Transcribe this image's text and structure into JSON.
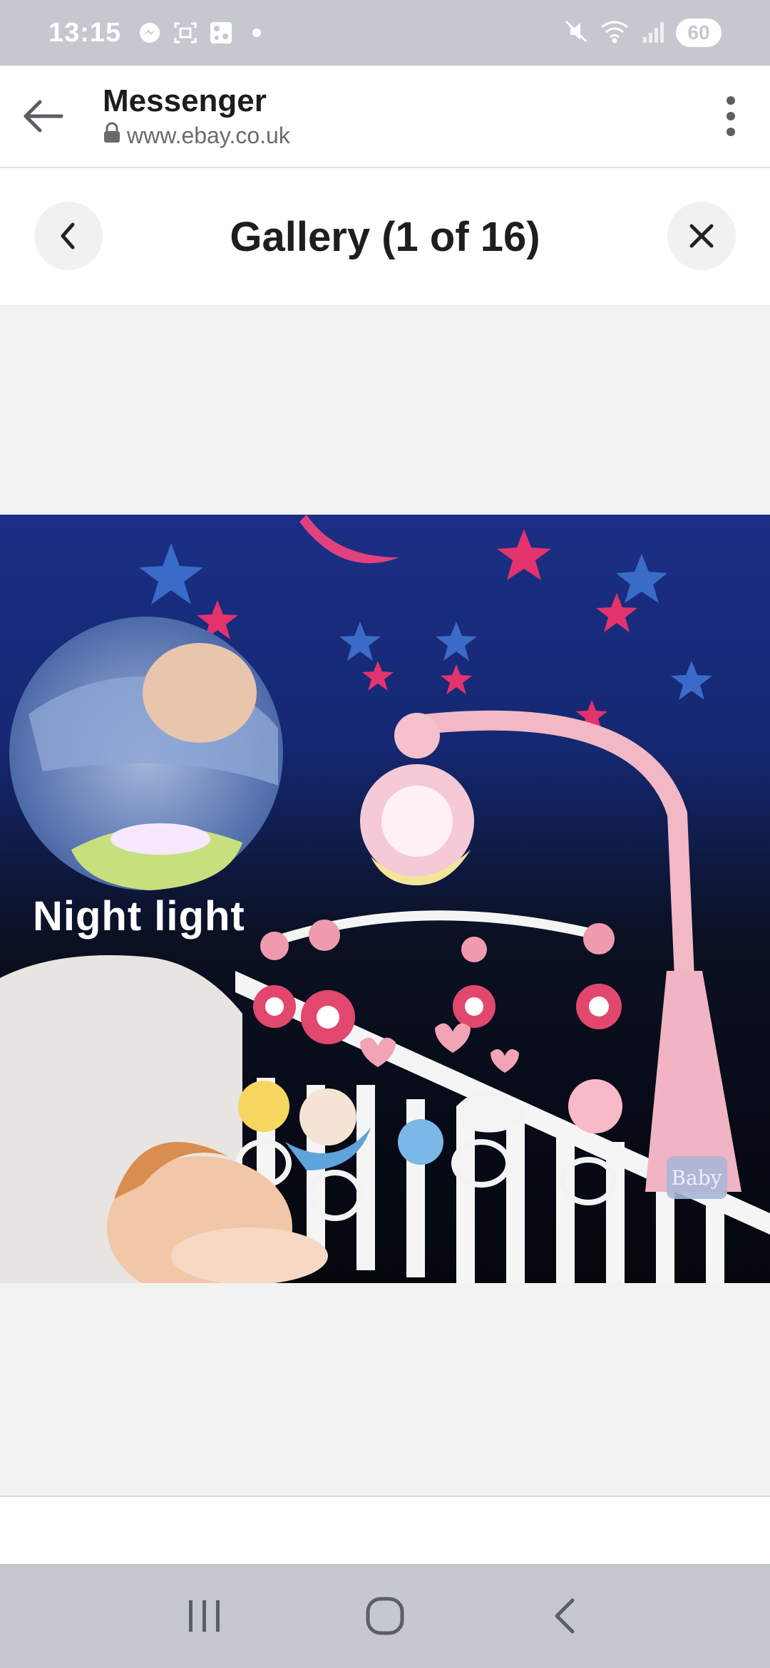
{
  "status_bar": {
    "time": "13:15",
    "battery": "60",
    "icons": [
      "messenger-icon",
      "screenshot-icon",
      "gallery-icon",
      "dot-icon",
      "mute-icon",
      "wifi-icon",
      "signal-icon"
    ]
  },
  "browser": {
    "title": "Messenger",
    "url": "www.ebay.co.uk"
  },
  "gallery": {
    "title": "Gallery (1 of 16)"
  },
  "image": {
    "caption": "Night light",
    "brand_text": "Baby"
  },
  "colors": {
    "status_bar": "#c5c8cf",
    "header_bg": "#ffffff",
    "page_bg": "#f2f2f2",
    "text_primary": "#1c1c1c"
  }
}
